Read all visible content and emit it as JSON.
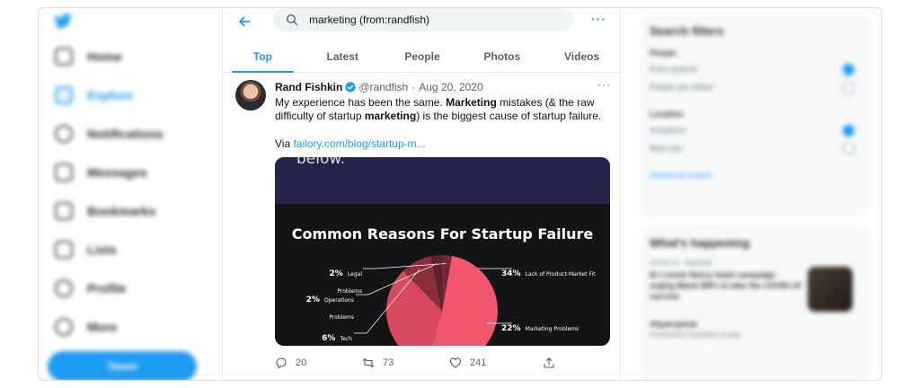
{
  "sidebar": {
    "items": [
      {
        "label": "Home",
        "icon": "home-icon",
        "active": false
      },
      {
        "label": "Explore",
        "icon": "hashtag-icon",
        "active": true
      },
      {
        "label": "Notifications",
        "icon": "bell-icon",
        "active": false
      },
      {
        "label": "Messages",
        "icon": "mail-icon",
        "active": false
      },
      {
        "label": "Bookmarks",
        "icon": "bookmark-icon",
        "active": false
      },
      {
        "label": "Lists",
        "icon": "list-icon",
        "active": false
      },
      {
        "label": "Profile",
        "icon": "person-icon",
        "active": false
      },
      {
        "label": "More",
        "icon": "more-circle-icon",
        "active": false
      }
    ],
    "tweet_button": "Tweet"
  },
  "search": {
    "query": "marketing (from:randfish)"
  },
  "tabs": [
    "Top",
    "Latest",
    "People",
    "Photos",
    "Videos"
  ],
  "tweet": {
    "author": "Rand Fishkin",
    "handle": "@randfish",
    "separator": "·",
    "date": "Aug 20, 2020",
    "text_part1": "My experience has been the same. ",
    "text_bold1": "Marketing",
    "text_part2": " mistakes (& the raw difficulty of startup ",
    "text_bold2": "marketing",
    "text_part3": ") is the biggest cause of startup failure.",
    "via_prefix": "Via ",
    "via_link": "failory.com/blog/startup-m...",
    "card": {
      "top_text": "below.",
      "title": "Common Reasons For Startup Failure"
    },
    "actions": {
      "replies": "20",
      "retweets": "73",
      "likes": "241"
    }
  },
  "chart_data": {
    "type": "pie",
    "title": "Common Reasons For Startup Failure",
    "slices": [
      {
        "pct": "34%",
        "label": "Lack of Product-Market Fit",
        "value": 34,
        "color": "#f0566e"
      },
      {
        "pct": "22%",
        "label": "Marketing Problems",
        "value": 22,
        "color": "#d84a60"
      },
      {
        "pct": "6%",
        "label": "Tech Problems",
        "value": 6,
        "color": "#8a2e3c"
      },
      {
        "pct": "2%",
        "label": "Operations Problems",
        "value": 2,
        "color": "#5c2029"
      },
      {
        "pct": "2%",
        "label": "Legal Problems",
        "value": 2,
        "color": "#74283a"
      }
    ]
  },
  "right": {
    "filters_title": "Search filters",
    "people_label": "People",
    "people_options": [
      "From anyone",
      "People you follow"
    ],
    "location_label": "Location",
    "location_options": [
      "Anywhere",
      "Near you"
    ],
    "advanced_link": "Advanced search",
    "trends_title": "What's happening",
    "trend1_meta": "COVID-19 · Yesterday",
    "trend1_text": "Dr Lonnie Nenry leads campaign urging Black BIPs to take the COVID-19 vaccine",
    "trend2_text": "#Hydrophob",
    "trend2_meta": "Promoted by PlayStation Europe"
  }
}
